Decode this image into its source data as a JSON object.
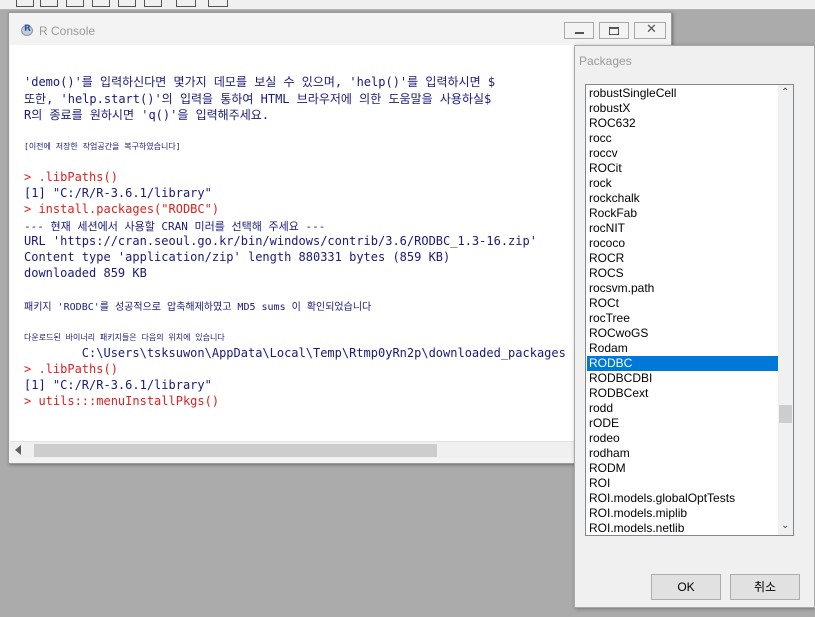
{
  "console": {
    "title": "R Console",
    "logo_letter": "R",
    "lines": [
      {
        "text": "'demo()'를 입력하신다면 몇가지 데모를 보실 수 있으며, 'help()'를 입력하시면 $",
        "style": "normal"
      },
      {
        "text": "또한, 'help.start()'의 입력을 통하여 HTML 브라우저에 의한 도움말을 사용하실$",
        "style": "normal"
      },
      {
        "text": "R의 종료를 원하시면 'q()'을 입력해주세요.",
        "style": "normal"
      },
      {
        "text": "[이전에 저장한 작업공간을 복구하였습니다]",
        "style": "small"
      },
      {
        "text": "> .libPaths()",
        "style": "red"
      },
      {
        "text": "[1] \"C:/R/R-3.6.1/library\"",
        "style": "normal"
      },
      {
        "text": "> install.packages(\"RODBC\")",
        "style": "red"
      },
      {
        "text": "--- 현재 세션에서 사용할 CRAN 미러를 선택해 주세요 ---",
        "style": "normal"
      },
      {
        "text": "URL 'https://cran.seoul.go.kr/bin/windows/contrib/3.6/RODBC_1.3-16.zip'",
        "style": "normal"
      },
      {
        "text": "Content type 'application/zip' length 880331 bytes (859 KB)",
        "style": "normal"
      },
      {
        "text": "downloaded 859 KB",
        "style": "normal"
      },
      {
        "text": "패키지 'RODBC'를 성공적으로 압축해제하였고 MD5 sums 이 확인되었습니다",
        "style": "normal"
      },
      {
        "text": "다운로드된 바이너리 패키지들은 다음의 위치에 있습니다",
        "style": "small"
      },
      {
        "text": "        C:\\Users\\tsksuwon\\AppData\\Local\\Temp\\Rtmp0yRn2p\\downloaded_packages",
        "style": "normal"
      },
      {
        "text": "> .libPaths()",
        "style": "red"
      },
      {
        "text": "[1] \"C:/R/R-3.6.1/library\"",
        "style": "normal"
      },
      {
        "text": "> utils:::menuInstallPkgs()",
        "style": "red"
      }
    ]
  },
  "packages_dialog": {
    "title": "Packages",
    "selected_item": "RODBC",
    "items": [
      "robustSingleCell",
      "robustX",
      "ROC632",
      "rocc",
      "roccv",
      "ROCit",
      "rock",
      "rockchalk",
      "RockFab",
      "rocNIT",
      "rococo",
      "ROCR",
      "ROCS",
      "rocsvm.path",
      "ROCt",
      "rocTree",
      "ROCwoGS",
      "Rodam",
      "RODBC",
      "RODBCDBI",
      "RODBCext",
      "rodd",
      "rODE",
      "rodeo",
      "rodham",
      "RODM",
      "ROI",
      "ROI.models.globalOptTests",
      "ROI.models.miplib",
      "ROI.models.netlib"
    ],
    "ok_label": "OK",
    "cancel_label": "취소"
  },
  "colors": {
    "console_text": "#1a1a7a",
    "console_command": "#e02020",
    "selection": "#0078d7"
  },
  "icons": {
    "minimize": "minimize-icon",
    "restore": "restore-icon",
    "close": "close-icon",
    "scroll_up": "scroll-up-icon",
    "scroll_down": "scroll-down-icon",
    "scroll_left": "scroll-left-icon"
  }
}
